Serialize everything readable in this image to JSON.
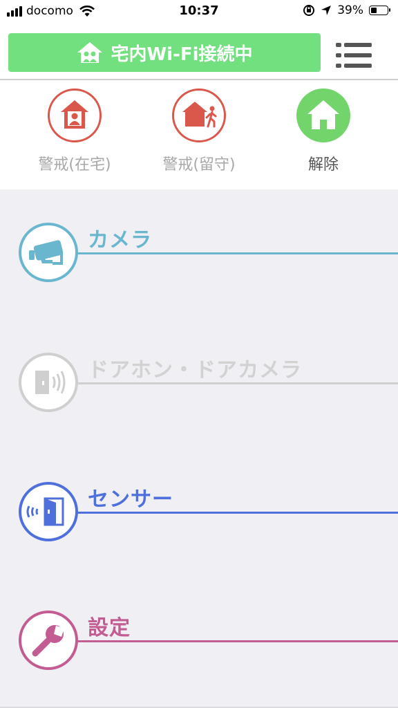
{
  "status_bar": {
    "carrier": "docomo",
    "time": "10:37",
    "battery_percent": "39%",
    "battery_level": 0.39
  },
  "header": {
    "wifi_status_label": "宅内Wi-Fi接続中",
    "menu_icon": "hamburger-menu-icon"
  },
  "modes": [
    {
      "label": "警戒(在宅)",
      "icon": "home-person-icon",
      "color": "#d9574b",
      "active": false
    },
    {
      "label": "警戒(留守)",
      "icon": "away-person-icon",
      "color": "#d9574b",
      "active": false
    },
    {
      "label": "解除",
      "icon": "home-icon",
      "color": "#72d46a",
      "active": true
    }
  ],
  "sections": [
    {
      "title": "カメラ",
      "icon": "camera-icon",
      "color": "#6ab6cf",
      "enabled": true
    },
    {
      "title": "ドアホン・ドアカメラ",
      "icon": "doorphone-icon",
      "color": "#cfcfcf",
      "enabled": false
    },
    {
      "title": "センサー",
      "icon": "door-sensor-icon",
      "color": "#4f6fdc",
      "enabled": true
    },
    {
      "title": "設定",
      "icon": "wrench-icon",
      "color": "#c25c93",
      "enabled": true
    }
  ]
}
